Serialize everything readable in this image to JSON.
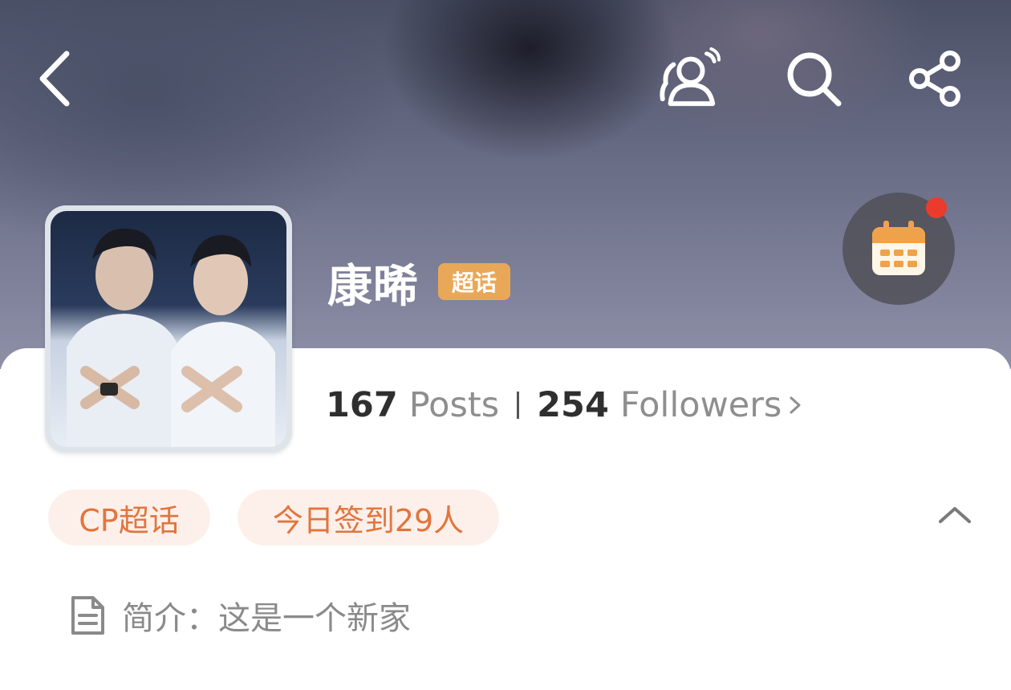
{
  "profile": {
    "name": "康晞",
    "badge": "超话",
    "posts_count": "167",
    "posts_label": "Posts",
    "followers_count": "254",
    "followers_label": "Followers"
  },
  "tags": {
    "cp": "CP超话",
    "checkin": "今日签到29人"
  },
  "intro": {
    "text": "简介：这是一个新家"
  },
  "icons": [
    "back-icon",
    "community-icon",
    "search-icon",
    "share-icon",
    "calendar-icon",
    "chevron-right-icon",
    "chevron-up-icon",
    "document-icon"
  ],
  "colors": {
    "badge": "#e9a857",
    "tag_text": "#e2753d",
    "tag_bg": "#fdf0ea",
    "notification_dot": "#ea3b2c"
  }
}
